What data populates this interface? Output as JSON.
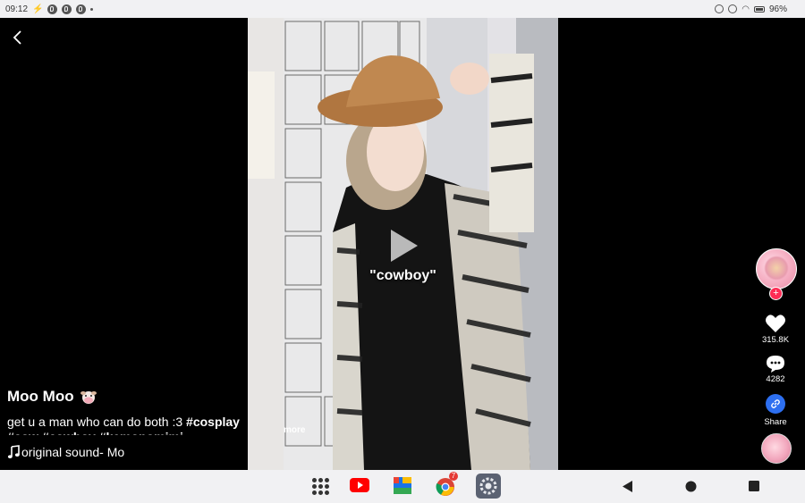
{
  "status_bar": {
    "time": "09:12",
    "battery": "96%"
  },
  "video": {
    "caption_overlay": "\"cowboy\""
  },
  "post": {
    "author": "Moo Moo",
    "description_prefix": "get u a man who can do both :3 ",
    "description_tags": "#cosplay",
    "description_cut": "#cow #cowboy #kemonomimi",
    "more_label": "more",
    "sound": "original sound- Mo"
  },
  "actions": {
    "likes": "315.8K",
    "comments": "4282",
    "share_label": "Share"
  },
  "nav": {
    "chrome_badge": "7",
    "apps": [
      "app-grid",
      "youtube",
      "drive",
      "chrome",
      "settings"
    ]
  }
}
